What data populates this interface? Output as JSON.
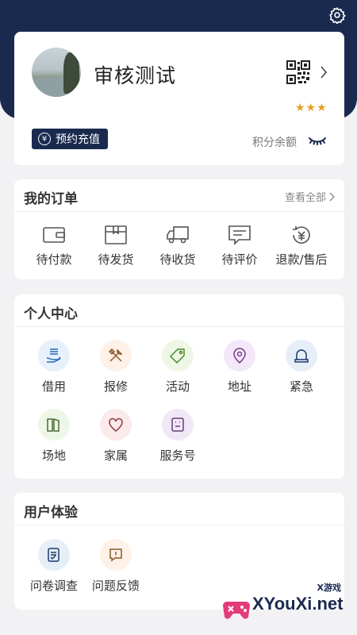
{
  "header": {
    "settings_icon": "gear-icon",
    "bg_color": "#1a2a4f"
  },
  "profile": {
    "username": "审核测试",
    "stars": "★★★",
    "recharge_label": "预约充值",
    "recharge_icon_glyph": "¥",
    "points_label": "积分余额"
  },
  "orders": {
    "title": "我的订单",
    "view_all": "查看全部",
    "items": [
      {
        "label": "待付款",
        "icon": "wallet-icon"
      },
      {
        "label": "待发货",
        "icon": "box-icon"
      },
      {
        "label": "待收货",
        "icon": "truck-icon"
      },
      {
        "label": "待评价",
        "icon": "message-icon"
      },
      {
        "label": "退款/售后",
        "icon": "refund-icon"
      }
    ]
  },
  "personal": {
    "title": "个人中心",
    "items": [
      {
        "label": "借用",
        "icon": "hand-borrow-icon"
      },
      {
        "label": "报修",
        "icon": "tools-icon"
      },
      {
        "label": "活动",
        "icon": "tag-icon"
      },
      {
        "label": "地址",
        "icon": "location-pin-icon"
      },
      {
        "label": "紧急",
        "icon": "alarm-bell-icon"
      },
      {
        "label": "场地",
        "icon": "venue-icon"
      },
      {
        "label": "家属",
        "icon": "heart-icon"
      },
      {
        "label": "服务号",
        "icon": "service-account-icon"
      }
    ]
  },
  "experience": {
    "title": "用户体验",
    "items": [
      {
        "label": "问卷调查",
        "icon": "survey-icon"
      },
      {
        "label": "问题反馈",
        "icon": "feedback-icon"
      }
    ]
  },
  "watermark": {
    "small": "X游戏",
    "text": "XYouXi.net"
  }
}
